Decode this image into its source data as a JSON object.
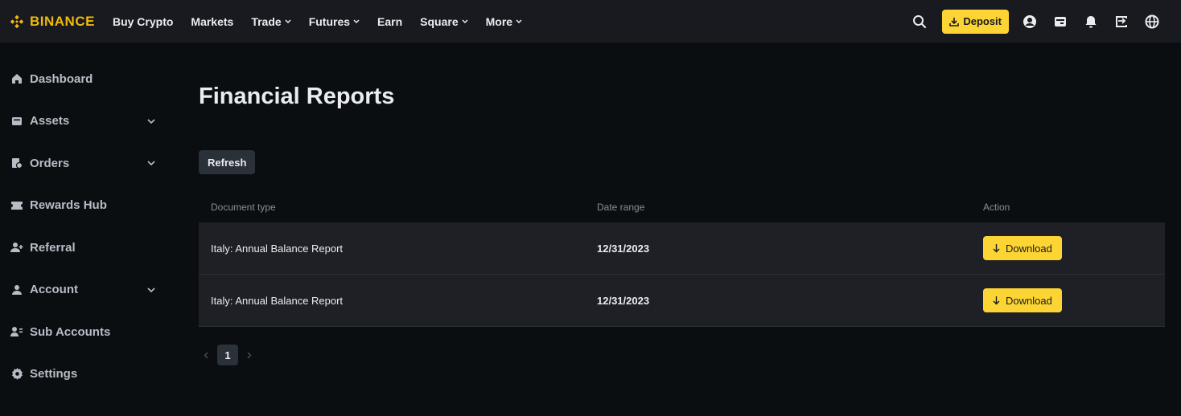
{
  "brand": {
    "name": "BINANCE",
    "color": "#f0b90b"
  },
  "nav": {
    "items": [
      {
        "label": "Buy Crypto",
        "dropdown": false
      },
      {
        "label": "Markets",
        "dropdown": false
      },
      {
        "label": "Trade",
        "dropdown": true
      },
      {
        "label": "Futures",
        "dropdown": true
      },
      {
        "label": "Earn",
        "dropdown": false
      },
      {
        "label": "Square",
        "dropdown": true
      },
      {
        "label": "More",
        "dropdown": true
      }
    ]
  },
  "header": {
    "deposit_label": "Deposit",
    "icons": [
      "search-icon",
      "download-icon",
      "user-icon",
      "wallet-icon",
      "bell-icon",
      "transfer-icon",
      "globe-icon"
    ]
  },
  "sidebar": {
    "items": [
      {
        "label": "Dashboard",
        "icon": "home-icon",
        "expandable": false
      },
      {
        "label": "Assets",
        "icon": "wallet-icon",
        "expandable": true
      },
      {
        "label": "Orders",
        "icon": "orders-icon",
        "expandable": true
      },
      {
        "label": "Rewards Hub",
        "icon": "ticket-icon",
        "expandable": false
      },
      {
        "label": "Referral",
        "icon": "add-user-icon",
        "expandable": false
      },
      {
        "label": "Account",
        "icon": "person-icon",
        "expandable": true
      },
      {
        "label": "Sub Accounts",
        "icon": "sub-accounts-icon",
        "expandable": false
      },
      {
        "label": "Settings",
        "icon": "gear-icon",
        "expandable": false
      }
    ]
  },
  "main": {
    "title": "Financial Reports",
    "refresh_label": "Refresh",
    "table": {
      "columns": [
        "Document type",
        "Date range",
        "Action"
      ],
      "rows": [
        {
          "document_type": "Italy: Annual Balance Report",
          "date_range": "12/31/2023",
          "action": "Download"
        },
        {
          "document_type": "Italy: Annual Balance Report",
          "date_range": "12/31/2023",
          "action": "Download"
        }
      ]
    },
    "pagination": {
      "current_page": "1"
    }
  },
  "colors": {
    "accent": "#fcd535",
    "background": "#0b0e11",
    "header_bg": "#181a20",
    "row_bg": "#1e2026"
  }
}
